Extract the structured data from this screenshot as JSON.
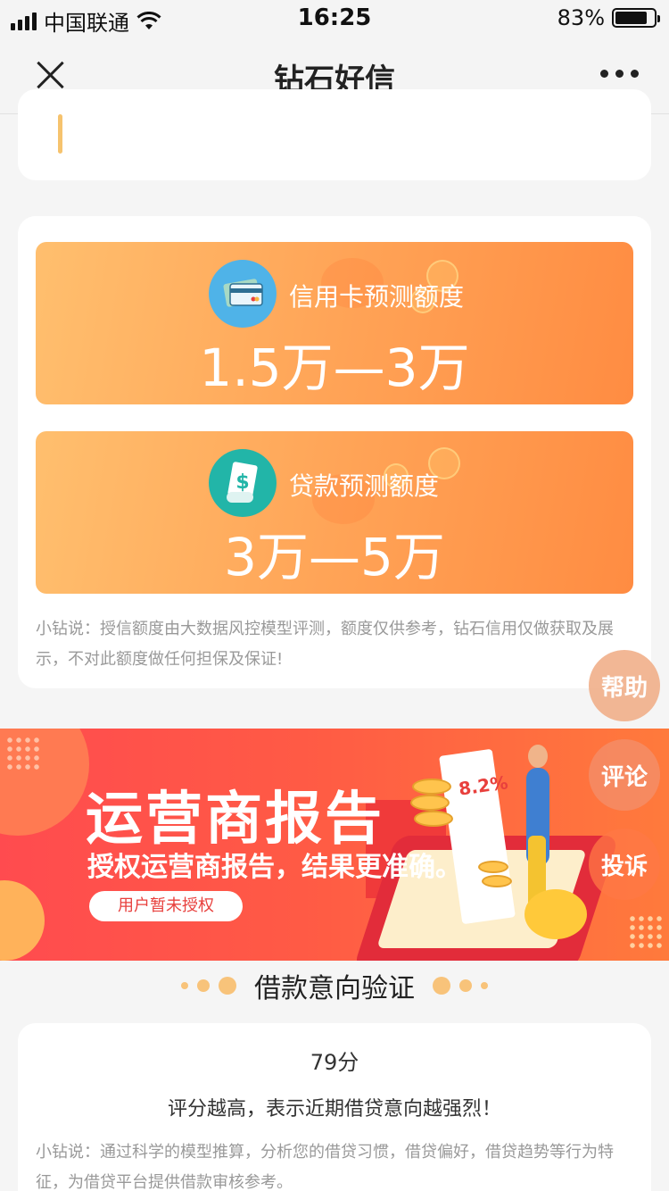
{
  "status_bar": {
    "carrier": "中国联通",
    "time": "16:25",
    "battery_percent": "83%"
  },
  "nav": {
    "title": "钻石好信",
    "close_icon": "close-icon",
    "more_icon": "more-icon"
  },
  "credit": {
    "card_label": "信用卡预测额度",
    "card_value": "1.5万—3万",
    "loan_label": "贷款预测额度",
    "loan_value": "3万—5万",
    "note": "小钻说：授信额度由大数据风控模型评测，额度仅供参考，钻石信用仅做获取及展示，不对此额度做任何担保及保证!"
  },
  "floating": {
    "help": "帮助",
    "comment": "评论",
    "complain": "投诉"
  },
  "banner": {
    "title": "运营商报告",
    "subtitle": "授权运营商报告，结果更准确。",
    "button": "用户暂未授权",
    "rate": "8.2%"
  },
  "intent": {
    "section_title": "借款意向验证",
    "score": "79分",
    "score_desc": "评分越高，表示近期借贷意向越强烈！",
    "note": "小钻说：通过科学的模型推算，分析您的借贷习惯，借贷偏好，借贷趋势等行为特征，为借贷平台提供借款审核参考。"
  },
  "colors": {
    "orange_start": "#ffbf6e",
    "orange_end": "#ff8c42",
    "banner_red": "#ff4b4f",
    "card_icon_blue": "#4fb3e8",
    "loan_icon_teal": "#22b5a8"
  }
}
